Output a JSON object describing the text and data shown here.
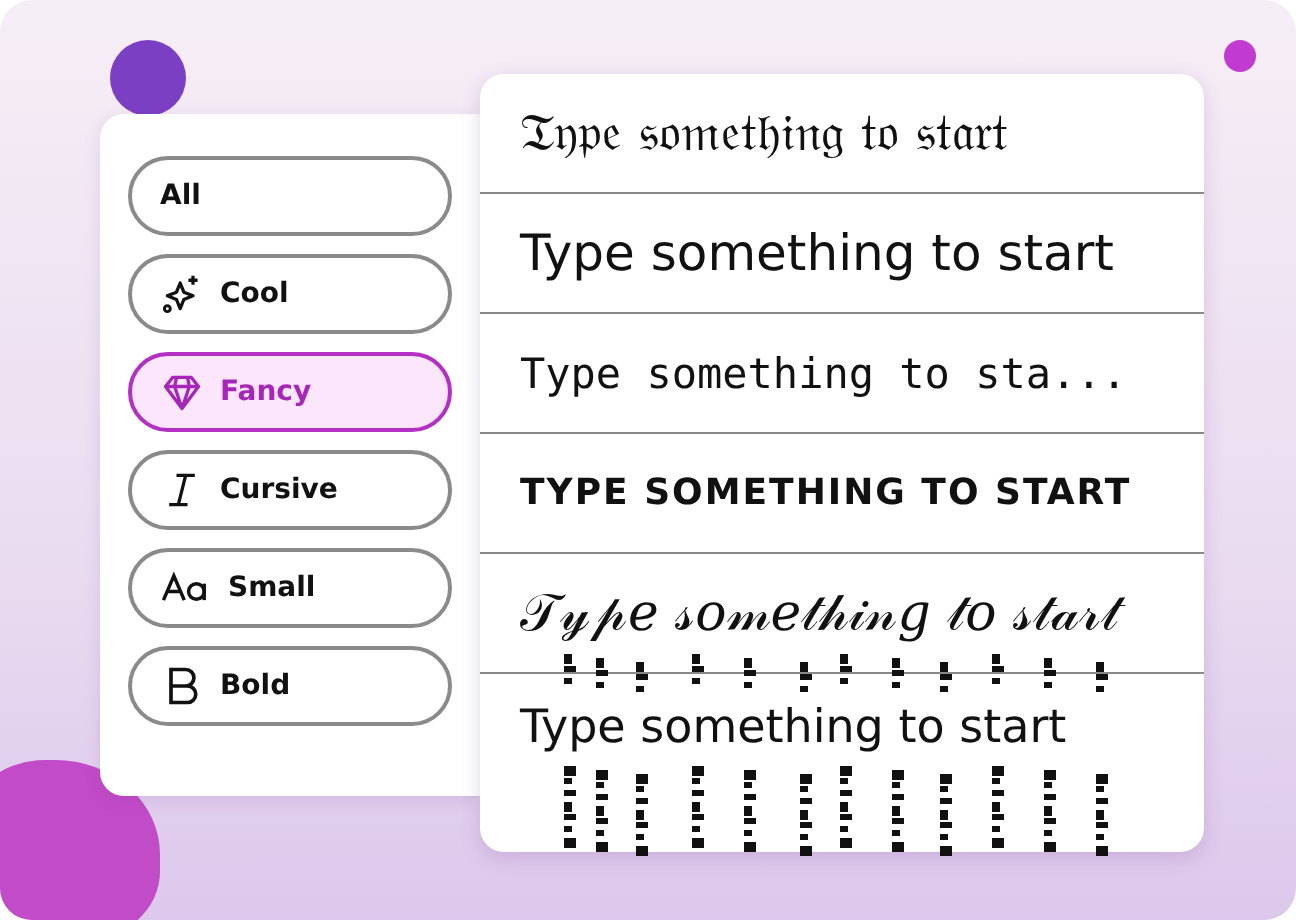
{
  "filters": [
    {
      "label": "All",
      "kind": "text",
      "selected": false
    },
    {
      "label": "Cool",
      "kind": "sparkle",
      "selected": false
    },
    {
      "label": "Fancy",
      "kind": "gem",
      "selected": true
    },
    {
      "label": "Cursive",
      "kind": "italic",
      "selected": false
    },
    {
      "label": "Small",
      "kind": "aa",
      "selected": false
    },
    {
      "label": "Bold",
      "kind": "bold",
      "selected": false
    }
  ],
  "results": [
    {
      "kind": "fraktur",
      "text": "𝔗𝔶𝔭𝔢 𝔰𝔬𝔪𝔢𝔱𝔥𝔦𝔫𝔤 𝔱𝔬 𝔰𝔱𝔞𝔯𝔱"
    },
    {
      "kind": "plain",
      "text": "Type something to start"
    },
    {
      "kind": "mono",
      "text": "Type something to sta..."
    },
    {
      "kind": "caps",
      "text": "TYPE SOMETHING TO START"
    },
    {
      "kind": "script",
      "text": "𝒯𝓎𝓅𝑒 𝓈𝑜𝓂𝑒𝓉𝒽𝒾𝓃𝑔 𝓉𝑜 𝓈𝓉𝒶𝓇𝓉"
    },
    {
      "kind": "glitch",
      "text": "Type something to start"
    }
  ]
}
